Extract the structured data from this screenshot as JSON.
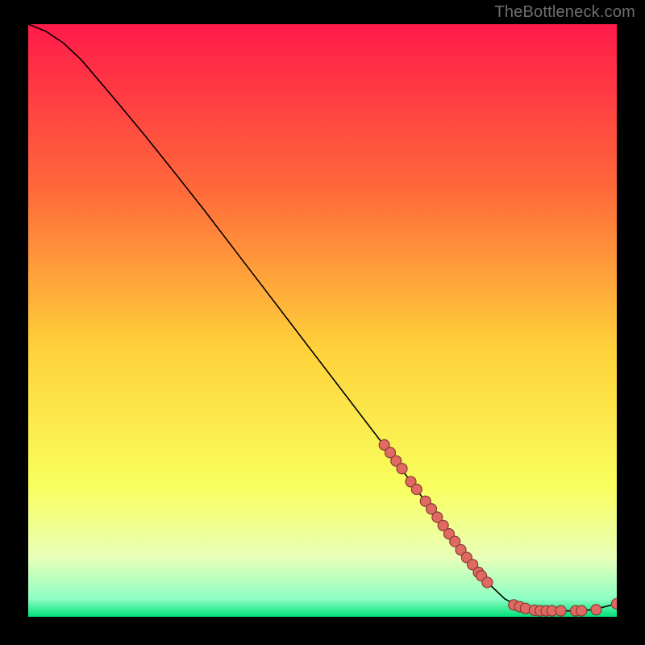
{
  "watermark": "TheBottleneck.com",
  "chart_data": {
    "type": "line",
    "title": "",
    "xlabel": "",
    "ylabel": "",
    "xlim": [
      0,
      100
    ],
    "ylim": [
      0,
      100
    ],
    "gradient_stops": [
      {
        "offset": 0,
        "color": "#ff1a4a"
      },
      {
        "offset": 28,
        "color": "#ff6a3a"
      },
      {
        "offset": 55,
        "color": "#ffd23a"
      },
      {
        "offset": 78,
        "color": "#f8ff5e"
      },
      {
        "offset": 90,
        "color": "#e9ffb8"
      },
      {
        "offset": 97,
        "color": "#8dffc4"
      },
      {
        "offset": 100,
        "color": "#00e07a"
      }
    ],
    "curve": [
      {
        "x": 0,
        "y": 100.0
      },
      {
        "x": 3,
        "y": 98.8
      },
      {
        "x": 6,
        "y": 96.8
      },
      {
        "x": 9,
        "y": 94.0
      },
      {
        "x": 12,
        "y": 90.5
      },
      {
        "x": 15,
        "y": 87.0
      },
      {
        "x": 20,
        "y": 81.0
      },
      {
        "x": 25,
        "y": 74.8
      },
      {
        "x": 30,
        "y": 68.5
      },
      {
        "x": 35,
        "y": 62.0
      },
      {
        "x": 40,
        "y": 55.5
      },
      {
        "x": 45,
        "y": 49.0
      },
      {
        "x": 50,
        "y": 42.5
      },
      {
        "x": 55,
        "y": 36.0
      },
      {
        "x": 60,
        "y": 29.5
      },
      {
        "x": 65,
        "y": 22.8
      },
      {
        "x": 70,
        "y": 16.0
      },
      {
        "x": 75,
        "y": 9.5
      },
      {
        "x": 78,
        "y": 5.8
      },
      {
        "x": 81,
        "y": 3.0
      },
      {
        "x": 84,
        "y": 1.5
      },
      {
        "x": 87,
        "y": 1.0
      },
      {
        "x": 90,
        "y": 1.0
      },
      {
        "x": 93,
        "y": 1.0
      },
      {
        "x": 96,
        "y": 1.2
      },
      {
        "x": 100,
        "y": 2.2
      }
    ],
    "markers": [
      {
        "x": 60.5,
        "y": 29.0
      },
      {
        "x": 61.5,
        "y": 27.7
      },
      {
        "x": 62.5,
        "y": 26.3
      },
      {
        "x": 63.5,
        "y": 25.0
      },
      {
        "x": 65.0,
        "y": 22.8
      },
      {
        "x": 66.0,
        "y": 21.5
      },
      {
        "x": 67.5,
        "y": 19.5
      },
      {
        "x": 68.5,
        "y": 18.2
      },
      {
        "x": 69.5,
        "y": 16.8
      },
      {
        "x": 70.5,
        "y": 15.4
      },
      {
        "x": 71.5,
        "y": 14.0
      },
      {
        "x": 72.5,
        "y": 12.7
      },
      {
        "x": 73.5,
        "y": 11.3
      },
      {
        "x": 74.5,
        "y": 10.0
      },
      {
        "x": 75.5,
        "y": 8.8
      },
      {
        "x": 76.5,
        "y": 7.5
      },
      {
        "x": 77.0,
        "y": 6.9
      },
      {
        "x": 78.0,
        "y": 5.8
      },
      {
        "x": 82.5,
        "y": 2.0
      },
      {
        "x": 83.5,
        "y": 1.7
      },
      {
        "x": 84.5,
        "y": 1.4
      },
      {
        "x": 86.0,
        "y": 1.1
      },
      {
        "x": 87.0,
        "y": 1.0
      },
      {
        "x": 88.0,
        "y": 1.0
      },
      {
        "x": 89.0,
        "y": 1.0
      },
      {
        "x": 90.5,
        "y": 1.0
      },
      {
        "x": 93.0,
        "y": 1.0
      },
      {
        "x": 94.0,
        "y": 1.0
      },
      {
        "x": 96.5,
        "y": 1.2
      },
      {
        "x": 100.0,
        "y": 2.2
      }
    ],
    "marker_style": {
      "fill": "#e06a62",
      "stroke": "#8a3a34",
      "r": 6.5
    },
    "line_color": "#000000"
  }
}
